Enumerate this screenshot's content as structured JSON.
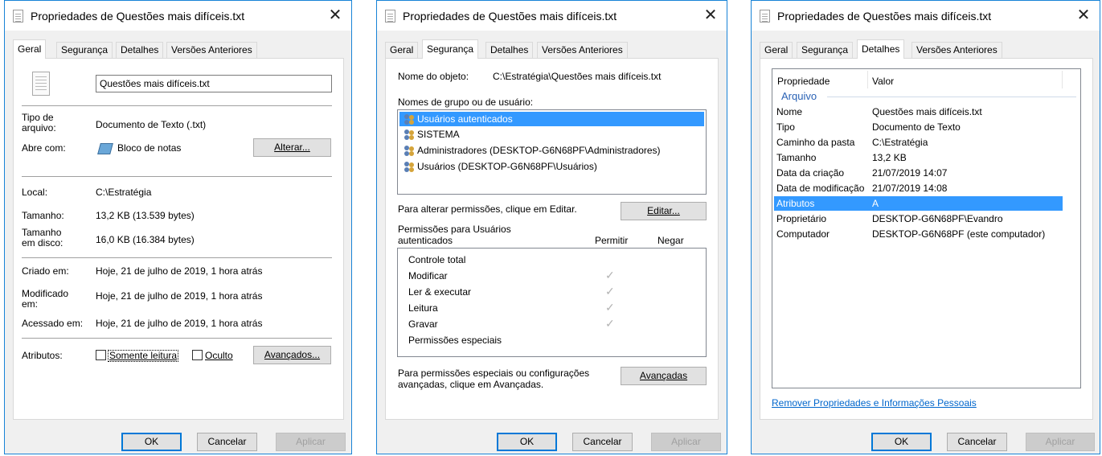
{
  "dialog_title": "Propriedades de Questões mais difíceis.txt",
  "close_glyph": "✕",
  "tabs": [
    "Geral",
    "Segurança",
    "Detalhes",
    "Versões Anteriores"
  ],
  "buttons": {
    "ok": "OK",
    "cancel": "Cancelar",
    "apply": "Aplicar"
  },
  "general": {
    "filename": "Questões mais difíceis.txt",
    "type_label": "Tipo de arquivo:",
    "type_value": "Documento de Texto (.txt)",
    "opens_label": "Abre com:",
    "opens_value": "Bloco de notas",
    "change_button": "Alterar...",
    "location_label": "Local:",
    "location_value": "C:\\Estratégia",
    "size_label": "Tamanho:",
    "size_value": "13,2 KB (13.539 bytes)",
    "size_disk_label": "Tamanho em disco:",
    "size_disk_value": "16,0 KB (16.384 bytes)",
    "created_label": "Criado em:",
    "created_value": "Hoje, 21 de julho de 2019, 1 hora atrás",
    "modified_label": "Modificado em:",
    "modified_value": "Hoje, 21 de julho de 2019, 1 hora atrás",
    "accessed_label": "Acessado em:",
    "accessed_value": "Hoje, 21 de julho de 2019, 1 hora atrás",
    "attributes_label": "Atributos:",
    "readonly_label": "Somente leitura",
    "hidden_label": "Oculto",
    "advanced_button": "Avançados..."
  },
  "security": {
    "object_label": "Nome do objeto:",
    "object_value": "C:\\Estratégia\\Questões mais difíceis.txt",
    "groups_label": "Nomes de grupo ou de usuário:",
    "groups": [
      "Usuários autenticados",
      "SISTEMA",
      "Administradores (DESKTOP-G6N68PF\\Administradores)",
      "Usuários (DESKTOP-G6N68PF\\Usuários)"
    ],
    "edit_hint": "Para alterar permissões, clique em Editar.",
    "edit_button": "Editar...",
    "perms_title_1": "Permissões para Usuários",
    "perms_title_2": "autenticados",
    "allow_header": "Permitir",
    "deny_header": "Negar",
    "permissions": [
      {
        "name": "Controle total",
        "allow": false
      },
      {
        "name": "Modificar",
        "allow": true
      },
      {
        "name": "Ler & executar",
        "allow": true
      },
      {
        "name": "Leitura",
        "allow": true
      },
      {
        "name": "Gravar",
        "allow": true
      },
      {
        "name": "Permissões especiais",
        "allow": false
      }
    ],
    "check_glyph": "✓",
    "special_hint_1": "Para permissões especiais ou configurações",
    "special_hint_2": "avançadas, clique em Avançadas.",
    "advanced_button": "Avançadas"
  },
  "details": {
    "col_property": "Propriedade",
    "col_value": "Valor",
    "section": "Arquivo",
    "rows": [
      {
        "prop": "Nome",
        "val": "Questões mais difíceis.txt"
      },
      {
        "prop": "Tipo",
        "val": "Documento de Texto"
      },
      {
        "prop": "Caminho da pasta",
        "val": "C:\\Estratégia"
      },
      {
        "prop": "Tamanho",
        "val": "13,2 KB"
      },
      {
        "prop": "Data da criação",
        "val": "21/07/2019 14:07"
      },
      {
        "prop": "Data de modificação",
        "val": "21/07/2019 14:08"
      },
      {
        "prop": "Atributos",
        "val": "A"
      },
      {
        "prop": "Proprietário",
        "val": "DESKTOP-G6N68PF\\Evandro"
      },
      {
        "prop": "Computador",
        "val": "DESKTOP-G6N68PF (este computador)"
      }
    ],
    "remove_link": "Remover Propriedades e Informações Pessoais"
  }
}
